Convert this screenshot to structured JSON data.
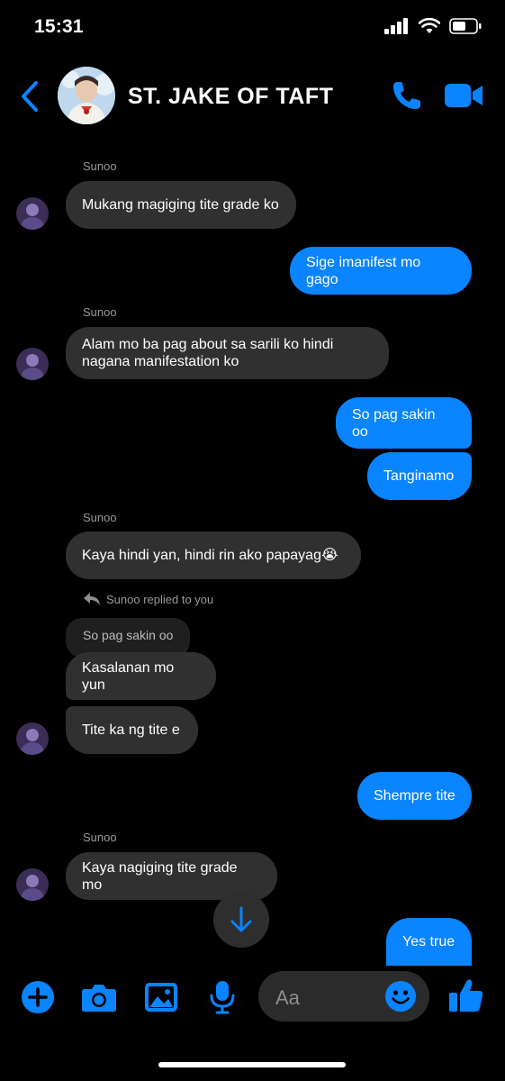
{
  "status": {
    "time": "15:31"
  },
  "header": {
    "contact_name": "ST. JAKE OF TAFT"
  },
  "messages": {
    "m1_sender": "Sunoo",
    "m1": "Mukang magiging tite grade ko",
    "m2": "Sige imanifest mo gago",
    "m3_sender": "Sunoo",
    "m3_line1": "Alam mo ba pag about sa sarili ko hindi",
    "m3_line2": "nagana manifestation ko",
    "m4_line1": "So pag sakin",
    "m4_line2": "oo",
    "m5": "Tanginamo",
    "m6_sender": "Sunoo",
    "m6": "Kaya hindi yan, hindi rin ako papayag😭",
    "reply_note": "Sunoo replied to you",
    "quoted": "So pag sakin oo",
    "m7": "Kasalanan mo yun",
    "m8": "Tite ka ng tite e",
    "m9": "Shempre tite",
    "m10_sender": "Sunoo",
    "m10": "Kaya nagiging tite grade mo",
    "m11": "Yes true"
  },
  "composer": {
    "placeholder": "Aa"
  },
  "colors": {
    "accent": "#0a84ff",
    "incoming": "#303030",
    "background": "#000000"
  }
}
